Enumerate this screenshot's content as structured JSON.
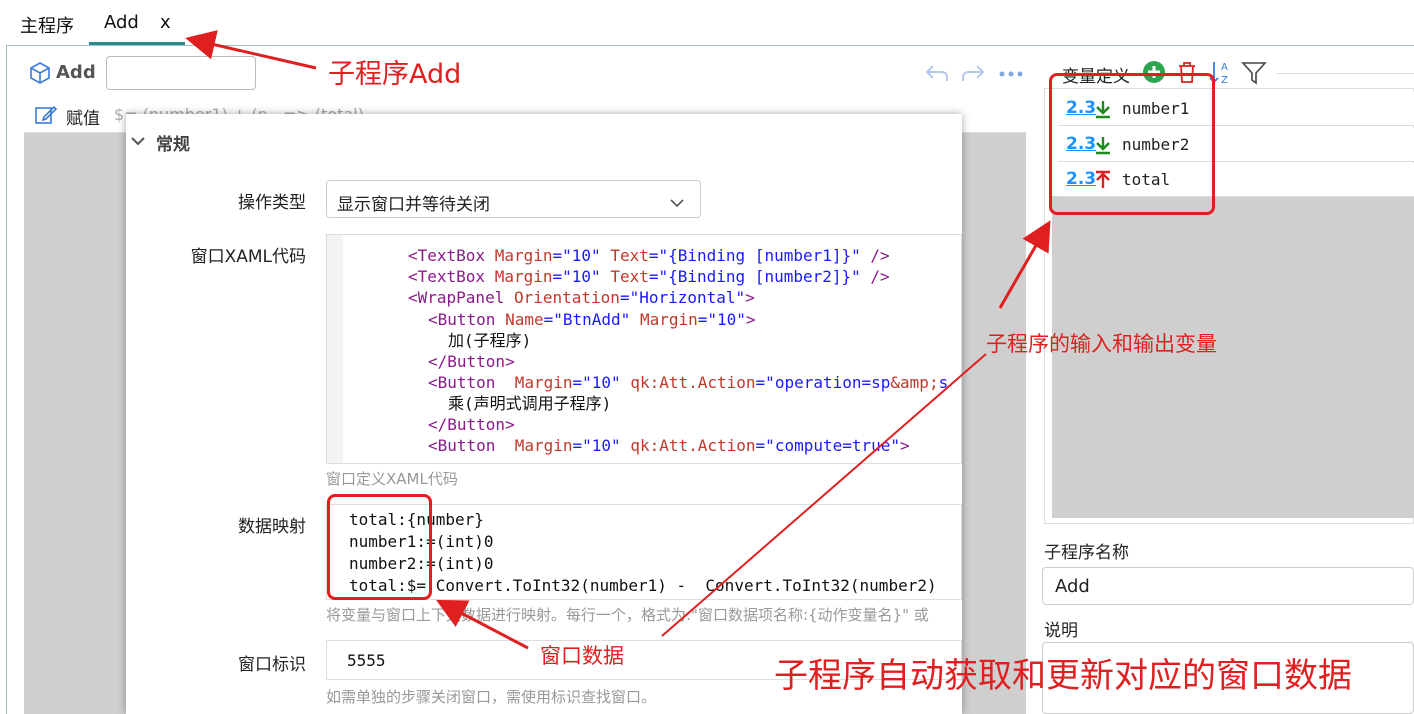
{
  "tabs": [
    {
      "label": "主程序"
    },
    {
      "label": "Add"
    }
  ],
  "tab_close": "x",
  "toolbar": {
    "name_label": "Add"
  },
  "step": {
    "label": "赋值",
    "expr": "$= (number1) + (n...=> (total)"
  },
  "dialog": {
    "section_title": "常规",
    "op_type_label": "操作类型",
    "op_type_value": "显示窗口并等待关闭",
    "xaml_label": "窗口XAML代码",
    "xaml_lines": [
      "<TextBox Margin=\"10\" Text=\"{Binding [number1]}\" />",
      "<TextBox Margin=\"10\" Text=\"{Binding [number2]}\" />",
      "<WrapPanel Orientation=\"Horizontal\">",
      "<Button Name=\"BtnAdd\" Margin=\"10\">",
      "加(子程序)",
      "</Button>",
      "<Button  Margin=\"10\" qk:Att.Action=\"operation=sp&amp;s",
      "乘(声明式调用子程序)",
      "</Button>",
      "<Button  Margin=\"10\" qk:Att.Action=\"compute=true\">"
    ],
    "xaml_hint": "窗口定义XAML代码",
    "mapping_label": "数据映射",
    "mapping_lines": [
      "total:{number}",
      "number1:=(int)0",
      "number2:=(int)0",
      "total:$= Convert.ToInt32(number1) -  Convert.ToInt32(number2)"
    ],
    "mapping_hint": "将变量与窗口上下文数据进行映射。每行一个，格式为:\"窗口数据项名称:{动作变量名}\" 或",
    "window_id_label": "窗口标识",
    "window_id_value": "5555",
    "window_id_hint": "如需单独的步骤关闭窗口，需使用标识查找窗口。"
  },
  "variables": {
    "title": "变量定义",
    "items": [
      {
        "type": "2.3",
        "name": "number1",
        "dir": "in"
      },
      {
        "type": "2.3",
        "name": "number2",
        "dir": "in"
      },
      {
        "type": "2.3",
        "name": "total",
        "dir": "out"
      }
    ]
  },
  "subprogram": {
    "name_label": "子程序名称",
    "name_value": "Add",
    "desc_label": "说明"
  },
  "annotations": {
    "sub_add": "子程序Add",
    "io_vars": "子程序的输入和输出变量",
    "window_data": "窗口数据",
    "auto_sync": "子程序自动获取和更新对应的窗口数据"
  },
  "colors": {
    "annotation": "#e02020",
    "tab_accent": "#2b8a8a",
    "in_arrow": "#1e8a1e",
    "out_arrow": "#e02020",
    "var_type": "#1e90ff"
  }
}
